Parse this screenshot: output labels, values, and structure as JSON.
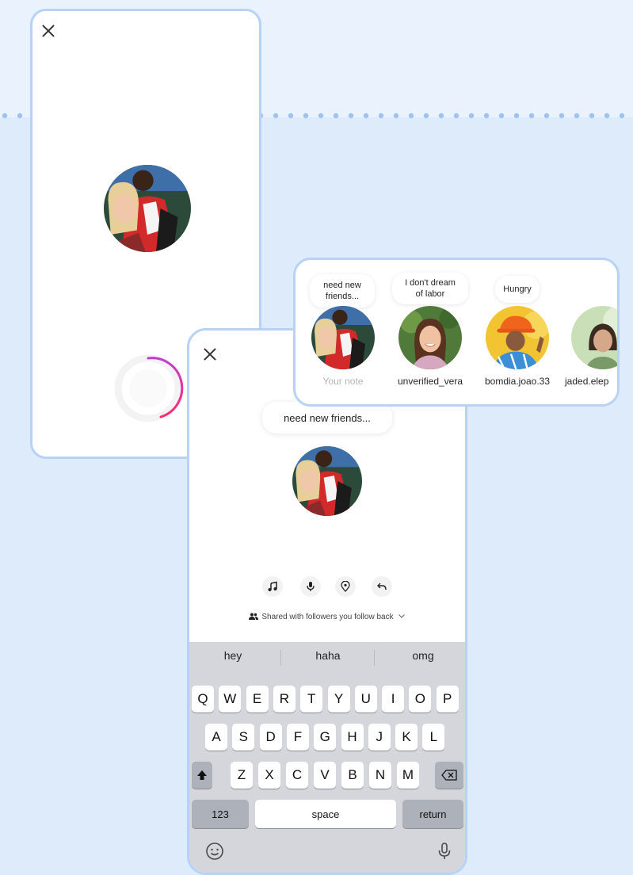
{
  "colors": {
    "page_bg": "#deebfb",
    "top_band": "#e9f2fd",
    "card_border": "#b6d2f6",
    "dot_color": "#9ec2f2",
    "spinner_gradient": [
      "#ff2d6f",
      "#c13bd1"
    ]
  },
  "loading_screen": {
    "close_icon": "close-icon",
    "avatar": "profile-photo",
    "spinner": "loading-spinner"
  },
  "notes_tray": {
    "items": [
      {
        "note": "need new friends...",
        "username": "Your note",
        "muted": true
      },
      {
        "note": "I don't dream of labor",
        "username": "unverified_vera",
        "muted": false
      },
      {
        "note": "Hungry",
        "username": "bomdia.joao.33",
        "muted": false
      },
      {
        "note": "",
        "username": "jaded.elep",
        "muted": false
      }
    ]
  },
  "compose_screen": {
    "close_icon": "close-icon",
    "note_text": "need new friends...",
    "tools": [
      "music-icon",
      "microphone-icon",
      "location-icon",
      "reply-icon"
    ],
    "audience_label": "Shared with followers you follow back"
  },
  "keyboard": {
    "suggestions": [
      "hey",
      "haha",
      "omg"
    ],
    "row1": [
      "Q",
      "W",
      "E",
      "R",
      "T",
      "Y",
      "U",
      "I",
      "O",
      "P"
    ],
    "row2": [
      "A",
      "S",
      "D",
      "F",
      "G",
      "H",
      "J",
      "K",
      "L"
    ],
    "row3": [
      "Z",
      "X",
      "C",
      "V",
      "B",
      "N",
      "M"
    ],
    "numbers_key": "123",
    "space_key": "space",
    "return_key": "return"
  }
}
